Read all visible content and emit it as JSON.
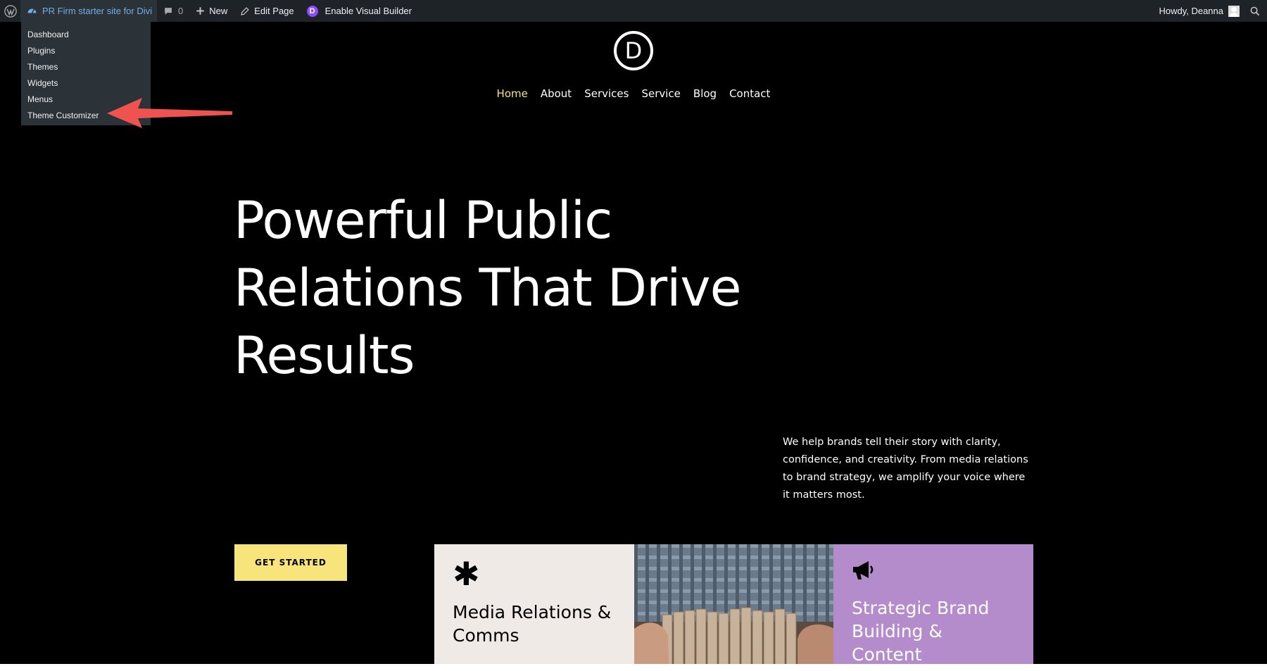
{
  "admin_bar": {
    "site_name": "PR Firm starter site for Divi",
    "comments_count": "0",
    "new_label": "New",
    "edit_page_label": "Edit Page",
    "divi_badge_letter": "D",
    "visual_builder_label": "Enable Visual Builder",
    "howdy_label": "Howdy, Deanna",
    "site_menu": [
      {
        "label": "Dashboard"
      },
      {
        "label": "Plugins"
      },
      {
        "label": "Themes"
      },
      {
        "label": "Widgets"
      },
      {
        "label": "Menus"
      },
      {
        "label": "Theme Customizer"
      }
    ]
  },
  "header": {
    "logo_letter": "D",
    "nav": [
      {
        "label": "Home",
        "active": true
      },
      {
        "label": "About"
      },
      {
        "label": "Services"
      },
      {
        "label": "Service"
      },
      {
        "label": "Blog"
      },
      {
        "label": "Contact"
      }
    ]
  },
  "hero": {
    "title_line1": "Powerful Public",
    "title_line2": "Relations That Drive",
    "title_line3": "Results",
    "text": "We help brands tell their story with clarity, confidence, and creativity. From media relations to brand strategy, we amplify your voice where it matters most.",
    "cta_label": "GET STARTED"
  },
  "cards": {
    "media": {
      "icon_glyph": "✱",
      "title": "Media Relations & Comms",
      "icon": "asterisk-icon"
    },
    "photo": {
      "icon": "wooden-blocks-photo"
    },
    "brand": {
      "title": "Strategic Brand Building & Content",
      "icon": "megaphone-icon"
    }
  },
  "colors": {
    "admin_bar_bg": "#1d2327",
    "site_link": "#72aee6",
    "nav_active": "#f6e27a",
    "cta_bg": "#f7e47a",
    "media_card_bg": "#efeae6",
    "brand_card_bg": "#b48ccc",
    "annotation_arrow": "#ef5350",
    "divi_purple": "#8c4bff"
  }
}
